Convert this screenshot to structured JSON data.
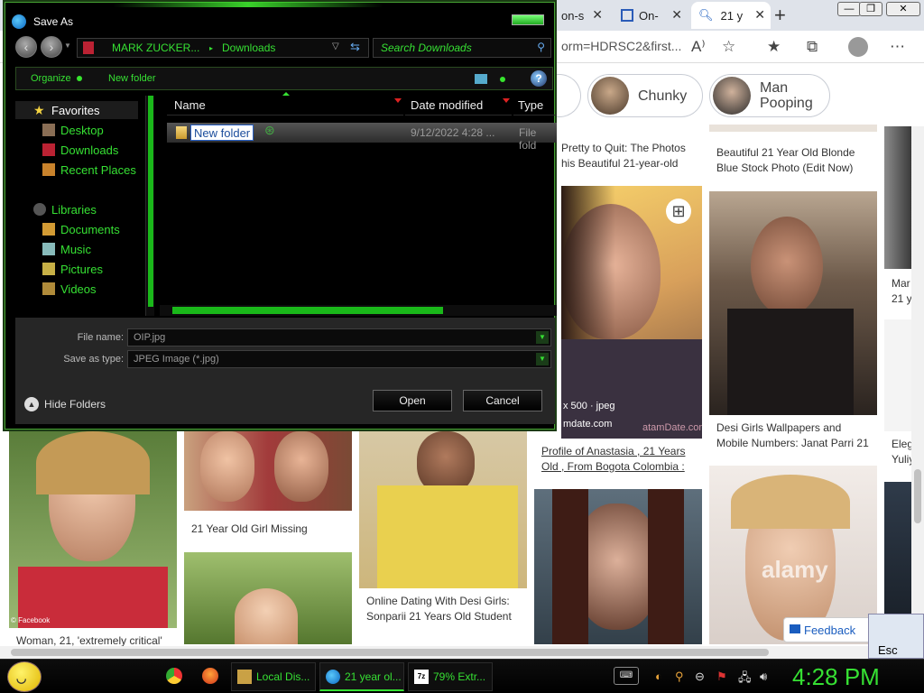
{
  "browser": {
    "tabs": [
      {
        "label": "on-s"
      },
      {
        "label": "On-"
      },
      {
        "label": "21 y"
      }
    ],
    "url": "orm=HDRSC2&first...",
    "people_pills": [
      {
        "name_line1": "Chunky",
        "name_line2": ""
      },
      {
        "name_line1": "Man",
        "name_line2": "Pooping"
      }
    ],
    "captions": {
      "c1_line1": "Pretty to Quit: The Photos",
      "c1_line2": "his Beautiful 21-year-old",
      "c2_line1": "Beautiful 21 Year Old Blonde",
      "c2_line2": "Blue Stock Photo (Edit Now)",
      "c3": "Mar",
      "c3b": "21 y",
      "c4_line1": "Profile of Anastasia , 21 Years",
      "c4_line2": "Old , From Bogota Colombia :",
      "c5_line1": "Desi Girls Wallpapers and",
      "c5_line2": "Mobile Numbers: Janat Parri 21",
      "c6_line1": "Eleg",
      "c6_line2": "Yuliy",
      "c7": "21 Year Old Girl Missing",
      "c8_line1": "Online Dating With Desi Girls:",
      "c8_line2": "Sonparii 21 Years Old Student",
      "c9": "Woman, 21, 'extremely critical'",
      "img_info_size": "x 500 · jpeg",
      "img_info_site": "mdate.com",
      "img_watermark": "atamDate.com",
      "facebook_tag": "© Facebook",
      "alamy": "alamy"
    },
    "feedback": "Feedback",
    "esc": "Esc"
  },
  "dialog": {
    "title": "Save As",
    "path_root": "MARK ZUCKER...",
    "path_sep": "▸",
    "path_current": "Downloads",
    "search_placeholder": "Search Downloads",
    "organize": "Organize",
    "new_folder": "New folder",
    "help": "?",
    "nav": {
      "favorites": "Favorites",
      "desktop": "Desktop",
      "downloads": "Downloads",
      "recent": "Recent Places",
      "libraries": "Libraries",
      "documents": "Documents",
      "music": "Music",
      "pictures": "Pictures",
      "videos": "Videos"
    },
    "columns": {
      "name": "Name",
      "date": "Date modified",
      "type": "Type"
    },
    "file_row": {
      "name": "New folder",
      "date": "9/12/2022 4:28 ...",
      "type": "File fold"
    },
    "filename_label": "File name:",
    "filename_value": "OIP.jpg",
    "savetype_label": "Save as type:",
    "savetype_value": "JPEG Image (*.jpg)",
    "hide_folders": "Hide Folders",
    "open": "Open",
    "cancel": "Cancel"
  },
  "taskbar": {
    "tasks": [
      {
        "label": "Local Dis..."
      },
      {
        "label": "21 year ol..."
      },
      {
        "label": "79% Extr..."
      }
    ],
    "clock": "4:28 PM"
  },
  "colors": {
    "accent": "#36e033",
    "dialog_bg": "#000000",
    "taskbar_bg": "#000000"
  }
}
